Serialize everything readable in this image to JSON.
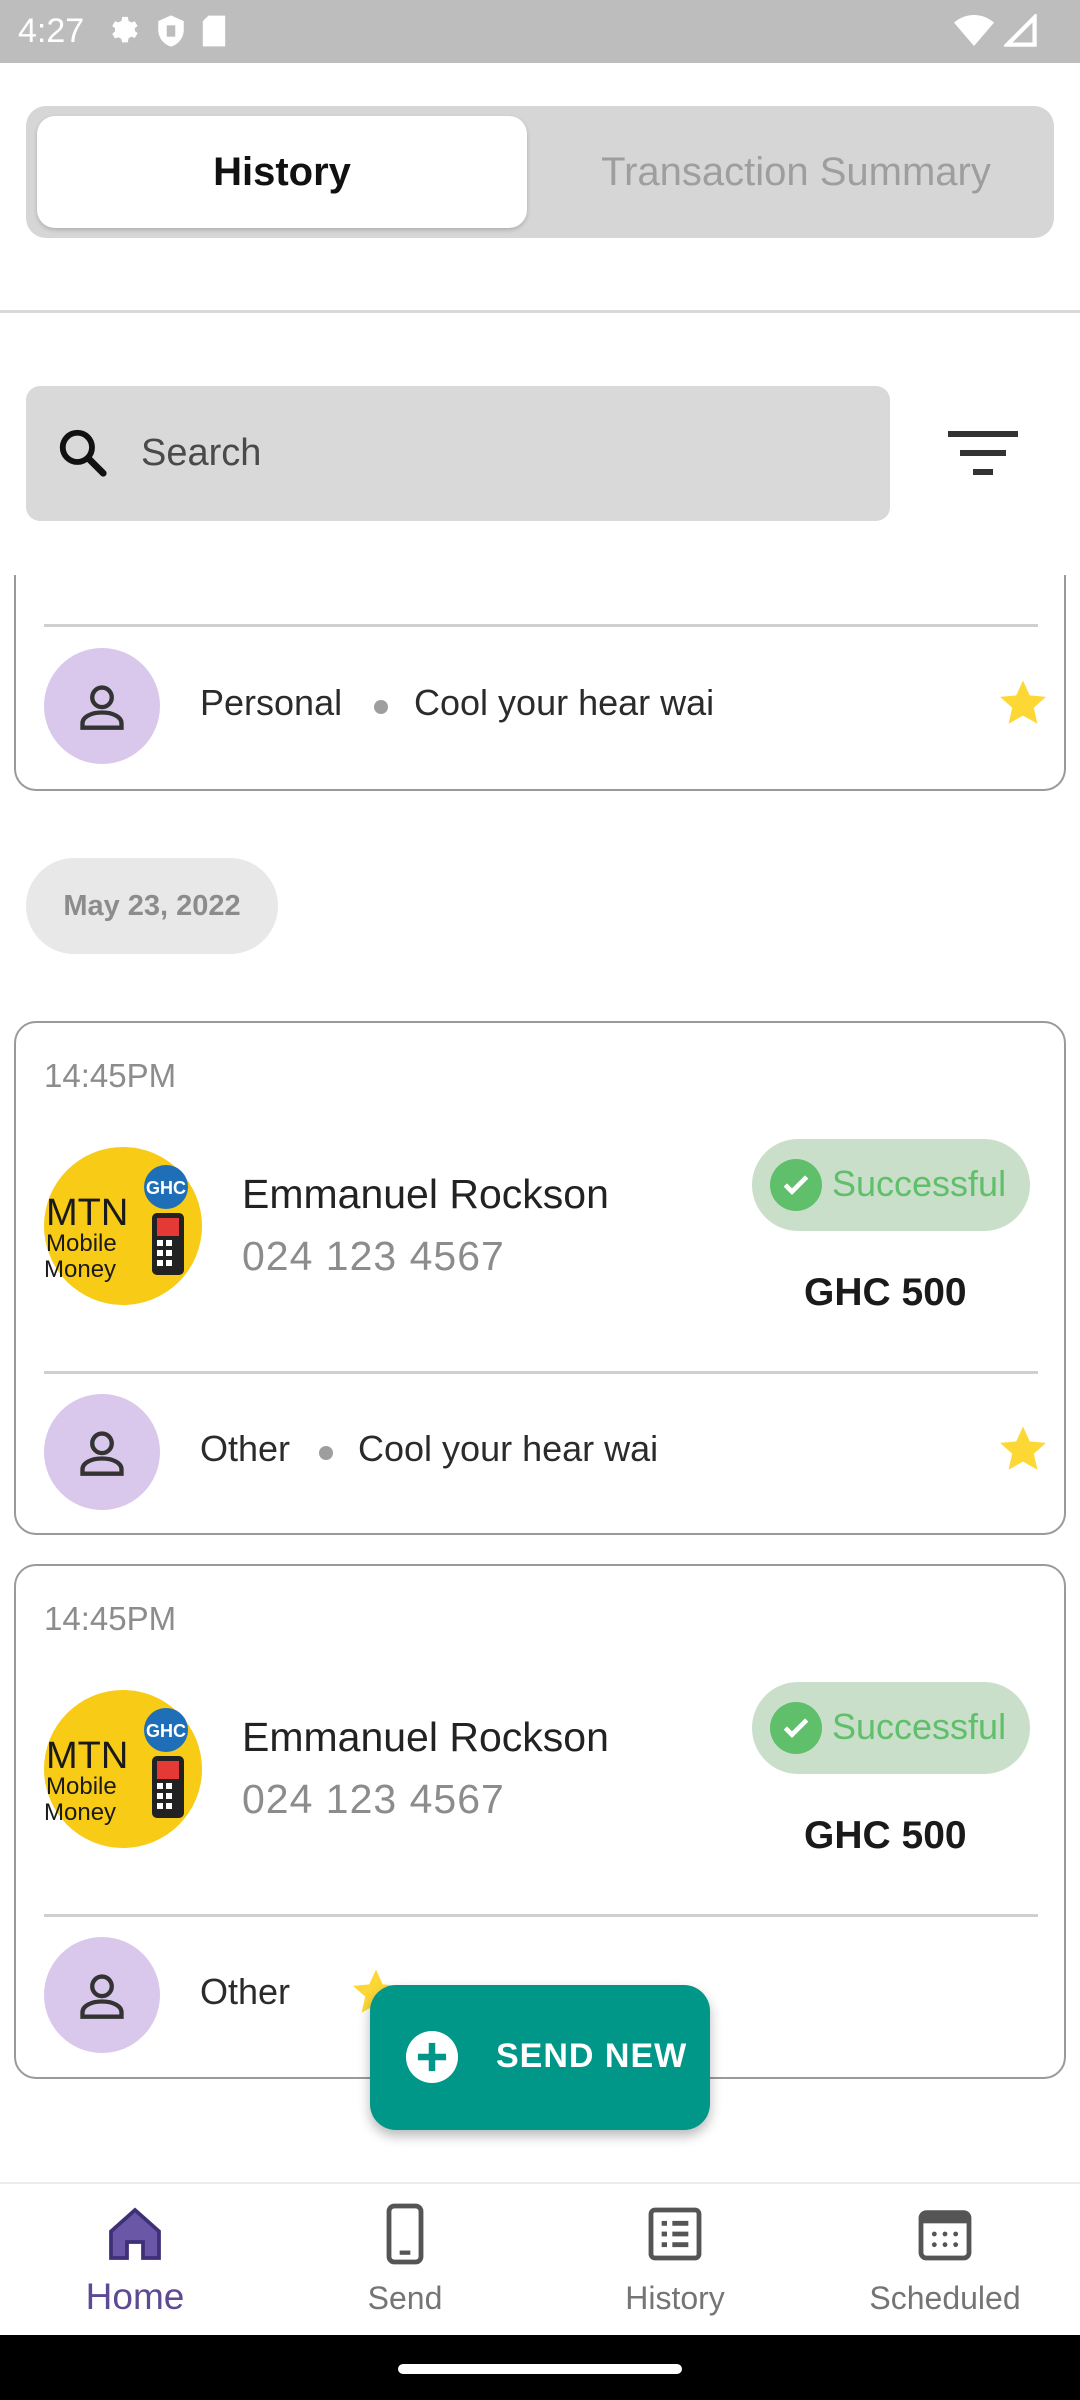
{
  "status_bar": {
    "time": "4:27"
  },
  "tabs": {
    "active": "History",
    "inactive": "Transaction Summary"
  },
  "search": {
    "placeholder": "Search"
  },
  "partial_card": {
    "category": "Personal",
    "note": "Cool your hear wai"
  },
  "date_chip": "May 23, 2022",
  "transactions": [
    {
      "time": "14:45PM",
      "name": "Emmanuel Rockson",
      "phone": "024 123 4567",
      "status": "Successful",
      "amount": "GHC 500",
      "category": "Other",
      "note": "Cool your hear wai"
    },
    {
      "time": "14:45PM",
      "name": "Emmanuel Rockson",
      "phone": "024 123 4567",
      "status": "Successful",
      "amount": "GHC 500",
      "category": "Other"
    }
  ],
  "provider_logo": {
    "line1": "MTN",
    "line2": "Mobile",
    "line3": "Money",
    "badge": "GHC"
  },
  "fab": {
    "label": "SEND NEW"
  },
  "bottom_nav": [
    {
      "label": "Home",
      "icon": "home-icon"
    },
    {
      "label": "Send",
      "icon": "phone-icon"
    },
    {
      "label": "History",
      "icon": "list-icon"
    },
    {
      "label": "Scheduled",
      "icon": "calendar-icon"
    }
  ],
  "colors": {
    "accent": "#5d4a93",
    "fab": "#009688",
    "success_text": "#5fbf6a",
    "success_bg": "#c9dfc9",
    "star": "#fdd835",
    "avatar_bg": "#d9c8ec"
  }
}
